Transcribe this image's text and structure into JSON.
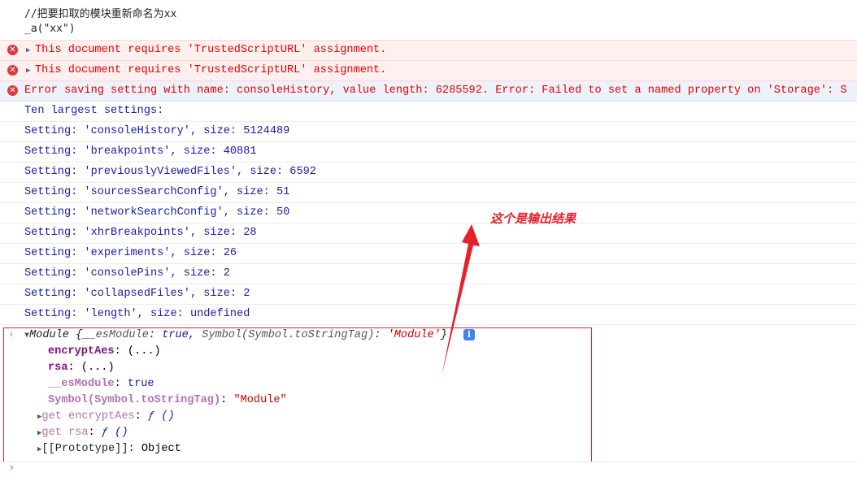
{
  "input_code": [
    "//把要扣取的模块重新命名为xx",
    "_a(\"xx\")"
  ],
  "errors": [
    "This document requires 'TrustedScriptURL' assignment.",
    "This document requires 'TrustedScriptURL' assignment."
  ],
  "storage_error": "Error saving setting with name: consoleHistory, value length: 6285592. Error: Failed to set a named property on 'Storage': S",
  "info_lines": [
    "Ten largest settings:",
    "Setting: 'consoleHistory', size: 5124489",
    "Setting: 'breakpoints', size: 40881",
    "Setting: 'previouslyViewedFiles', size: 6592",
    "Setting: 'sourcesSearchConfig', size: 51",
    "Setting: 'networkSearchConfig', size: 50",
    "Setting: 'xhrBreakpoints', size: 28",
    "Setting: 'experiments', size: 26",
    "Setting: 'consolePins', size: 2",
    "Setting: 'collapsedFiles', size: 2",
    "Setting: 'length', size: undefined"
  ],
  "module": {
    "summary_prefix": "Module {",
    "summary_k1": "__esModule",
    "summary_v1": "true",
    "summary_k2": "Symbol(Symbol.toStringTag)",
    "summary_v2": "'Module'",
    "summary_suffix": "}",
    "props": [
      {
        "key": "encryptAes",
        "value": "(...)"
      },
      {
        "key": "rsa",
        "value": "(...)"
      },
      {
        "key": "__esModule",
        "value": "true"
      },
      {
        "key": "Symbol(Symbol.toStringTag)",
        "value": "\"Module\""
      }
    ],
    "getters": [
      {
        "key": "get encryptAes",
        "value": "ƒ ()"
      },
      {
        "key": "get rsa",
        "value": "ƒ ()"
      }
    ],
    "prototype": {
      "key": "[[Prototype]]",
      "value": "Object"
    }
  },
  "annotation": "这个是输出结果",
  "colors": {
    "annotation": "#e8202a",
    "error": "#e40000",
    "info": "#1a1aa6"
  }
}
